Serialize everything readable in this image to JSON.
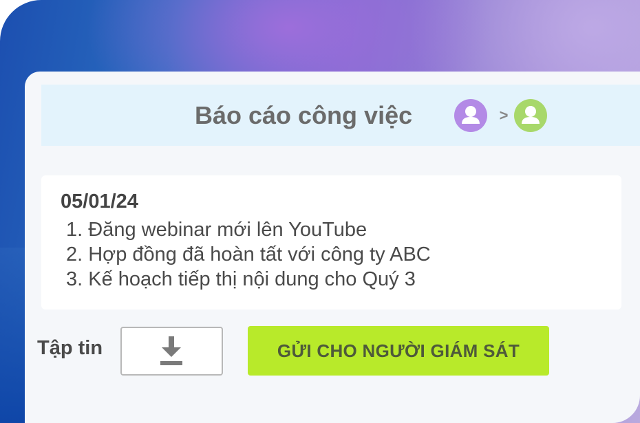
{
  "header": {
    "title": "Báo cáo công việc",
    "arrow": ">",
    "sender_icon": "user-avatar-icon",
    "recipient_icon": "user-avatar-icon"
  },
  "report": {
    "date": "05/01/24",
    "items": [
      "1. Đăng webinar mới lên YouTube",
      "2. Hợp đồng đã hoàn tất với công ty ABC",
      "3. Kế hoạch tiếp thị nội dung cho Quý 3"
    ]
  },
  "footer": {
    "files_label": "Tập tin",
    "upload_icon": "download-icon",
    "send_label": "GỬI CHO NGƯỜI GIÁM SÁT"
  },
  "colors": {
    "header_bg": "#e3f3fc",
    "sender_avatar": "#b38ae6",
    "recipient_avatar": "#a8d86a",
    "send_button": "#b8ea2a"
  }
}
